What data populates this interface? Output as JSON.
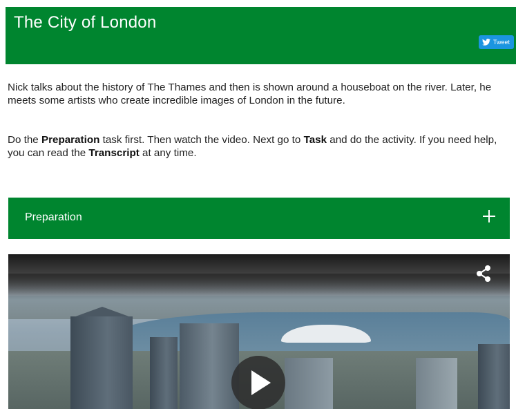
{
  "header": {
    "title": "The City of London",
    "tweet_label": "Tweet"
  },
  "intro": {
    "text": "Nick talks about the history of The Thames and then is shown around a houseboat on the river. Later, he meets some artists who create incredible images of London in the future."
  },
  "instructions": {
    "part1": "Do the ",
    "preparation": "Preparation",
    "part2": " task first. Then watch the video. Next go to ",
    "task": "Task",
    "part3": " and do the activity. If you need help, you can read the ",
    "transcript": "Transcript",
    "part4": " at any time."
  },
  "accordion": {
    "label": "Preparation",
    "icon": "plus-icon"
  },
  "video": {
    "share_icon": "share-icon",
    "play_icon": "play-icon"
  },
  "colors": {
    "brand_green": "#00852f",
    "twitter_blue": "#1b95e0"
  }
}
